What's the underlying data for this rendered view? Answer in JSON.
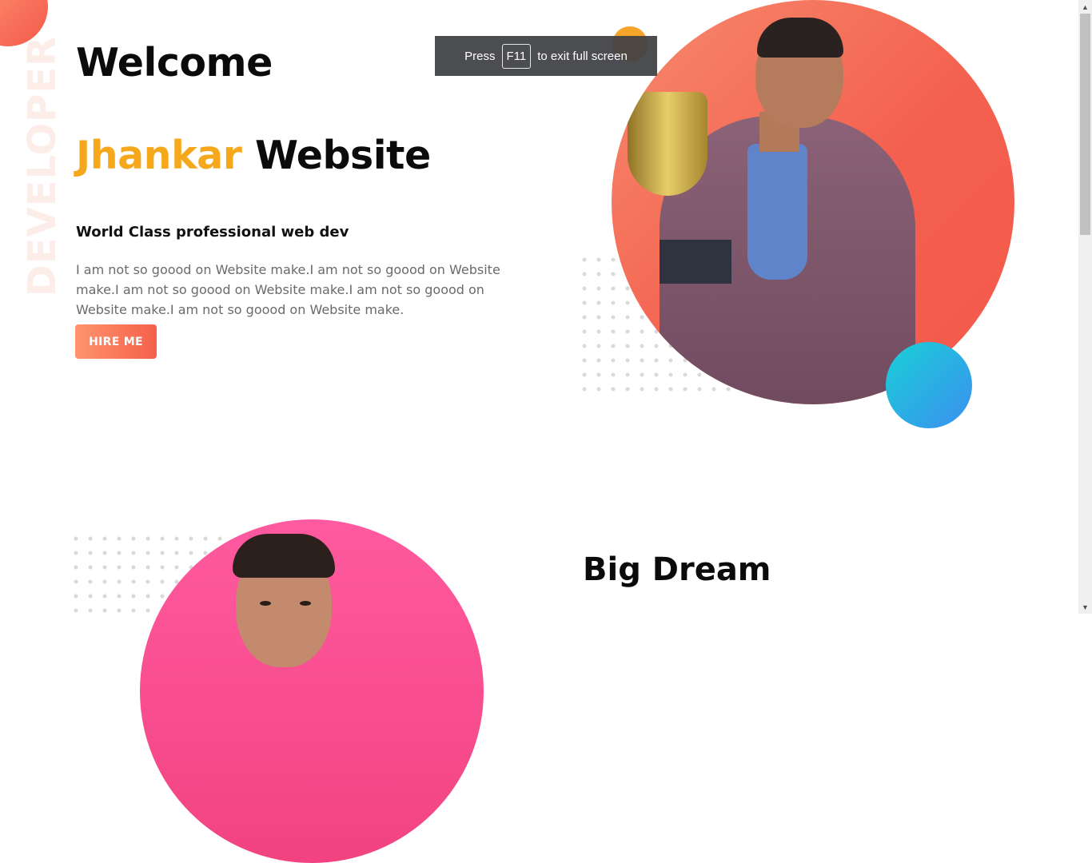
{
  "hero": {
    "vertical_word": "DEVELOPER",
    "title": "Welcome",
    "brand_accent": "Jhankar",
    "brand_rest": " Website",
    "tagline": "World Class professional web dev",
    "description": "I am not so goood on Website make.I am not so goood on Website make.I am not so goood on Website make.I am not so goood on Website make.I am not so goood on Website make.",
    "cta_label": "HIRE ME"
  },
  "fullscreen_toast": {
    "prefix": "Press",
    "key": "F11",
    "suffix": "to exit full screen"
  },
  "about": {
    "title": "Big Dream"
  },
  "colors": {
    "accent_orange": "#f6a81d",
    "cta_gradient_start": "#ff946e",
    "cta_gradient_end": "#f4604b",
    "portrait_bg_1": "#f4604f",
    "portrait_bg_2": "#f24380",
    "teal_ball": "#1ad0d6"
  },
  "scrollbar": {
    "up_icon": "triangle-up-icon",
    "down_icon": "triangle-down-icon"
  }
}
